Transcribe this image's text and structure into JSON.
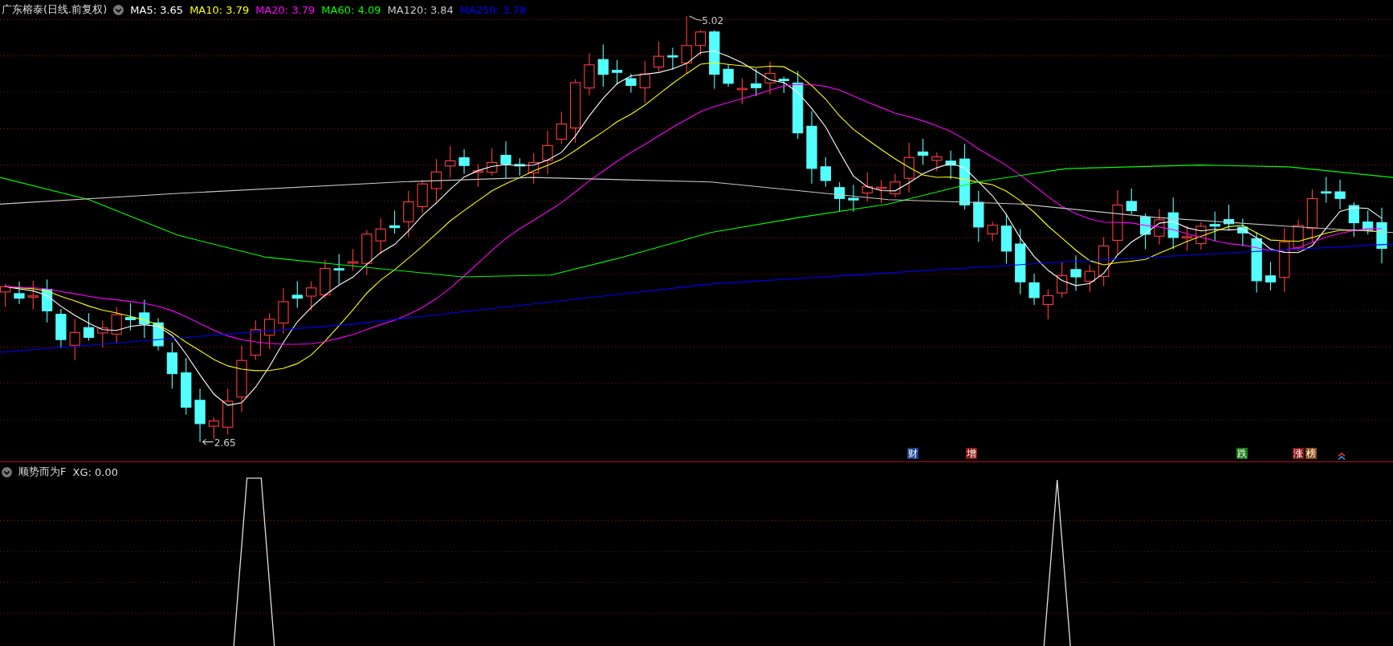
{
  "main_pane": {
    "title": "广东榕泰(日线.前复权)",
    "moving_averages": [
      {
        "text": "MA5: 3.65",
        "color": "#ffffff"
      },
      {
        "text": "MA10: 3.79",
        "color": "#ffff00"
      },
      {
        "text": "MA20: 3.79",
        "color": "#ff00ff"
      },
      {
        "text": "MA60: 4.09",
        "color": "#00ff00"
      },
      {
        "text": "MA120: 3.84",
        "color": "#c8c8c8"
      },
      {
        "text": "MA250: 3.78",
        "color": "#0000ff"
      }
    ],
    "high_label": "5.02",
    "low_label": "2.65",
    "events": [
      {
        "text": "财",
        "color": "#1c3f8f"
      },
      {
        "text": "增",
        "color": "#8b1414"
      },
      {
        "text": "跌",
        "color": "#157a15"
      },
      {
        "text": "涨",
        "color": "#8b1414"
      },
      {
        "text": "榜",
        "color": "#8a4a12"
      }
    ]
  },
  "indicator_pane": {
    "title": "顺势而为F",
    "reading": "XG: 0.00"
  }
}
